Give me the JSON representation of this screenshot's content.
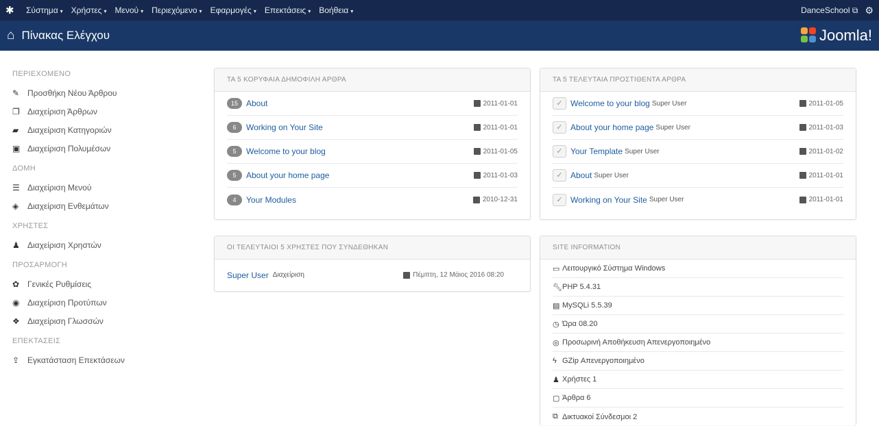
{
  "topbar": {
    "menu": [
      "Σύστημα",
      "Χρήστες",
      "Μενού",
      "Περιεχόμενο",
      "Εφαρμογές",
      "Επεκτάσεις",
      "Βοήθεια"
    ],
    "site_name": "DanceSchool"
  },
  "title": {
    "page_title": "Πίνακας Ελέγχου",
    "brand": "Joomla!"
  },
  "sidebar": {
    "sections": [
      {
        "heading": "ΠΕΡΙΕΧΟΜΕΝΟ",
        "items": [
          {
            "label": "Προσθήκη Νέου Άρθρου",
            "icon": "pencil-icon"
          },
          {
            "label": "Διαχείριση Άρθρων",
            "icon": "stack-icon"
          },
          {
            "label": "Διαχείριση Κατηγοριών",
            "icon": "folder-icon"
          },
          {
            "label": "Διαχείριση Πολυμέσων",
            "icon": "image-icon"
          }
        ]
      },
      {
        "heading": "ΔΟΜΗ",
        "items": [
          {
            "label": "Διαχείριση Μενού",
            "icon": "list-icon"
          },
          {
            "label": "Διαχείριση Ενθεμάτων",
            "icon": "cube-icon"
          }
        ]
      },
      {
        "heading": "ΧΡΗΣΤΕΣ",
        "items": [
          {
            "label": "Διαχείριση Χρηστών",
            "icon": "users-icon"
          }
        ]
      },
      {
        "heading": "ΠΡΟΣΑΡΜΟΓΗ",
        "items": [
          {
            "label": "Γενικές Ρυθμίσεις",
            "icon": "cog-icon"
          },
          {
            "label": "Διαχείριση Προτύπων",
            "icon": "eye-icon"
          },
          {
            "label": "Διαχείριση Γλωσσών",
            "icon": "comments-icon"
          }
        ]
      },
      {
        "heading": "ΕΠΕΚΤΑΣΕΙΣ",
        "items": [
          {
            "label": "Εγκατάσταση Επεκτάσεων",
            "icon": "upload-icon"
          }
        ]
      }
    ]
  },
  "popular": {
    "heading": "ΤΑ 5 ΚΟΡΥΦΑΙΑ ΔΗΜΟΦΙΛΗ ΑΡΘΡΑ",
    "rows": [
      {
        "hits": "15",
        "title": "About",
        "date": "2011-01-01"
      },
      {
        "hits": "6",
        "title": "Working on Your Site",
        "date": "2011-01-01"
      },
      {
        "hits": "5",
        "title": "Welcome to your blog",
        "date": "2011-01-05"
      },
      {
        "hits": "5",
        "title": "About your home page",
        "date": "2011-01-03"
      },
      {
        "hits": "4",
        "title": "Your Modules",
        "date": "2010-12-31"
      }
    ]
  },
  "latest": {
    "heading": "ΤΑ 5 ΤΕΛΕΥΤΑΙΑ ΠΡΟΣΤΙΘΕΝΤΑ ΑΡΘΡΑ",
    "rows": [
      {
        "title": "Welcome to your blog",
        "author": "Super User",
        "date": "2011-01-05"
      },
      {
        "title": "About your home page",
        "author": "Super User",
        "date": "2011-01-03"
      },
      {
        "title": "Your Template",
        "author": "Super User",
        "date": "2011-01-02"
      },
      {
        "title": "About",
        "author": "Super User",
        "date": "2011-01-01"
      },
      {
        "title": "Working on Your Site",
        "author": "Super User",
        "date": "2011-01-01"
      }
    ]
  },
  "logged": {
    "heading": "ΟΙ ΤΕΛΕΥΤΑΙΟΙ 5 ΧΡΗΣΤΕΣ ΠΟΥ ΣΥΝΔΕΘΗΚΑΝ",
    "rows": [
      {
        "name": "Super User",
        "client": "Διαχείριση",
        "date": "Πέμπτη, 12 Μάιος 2016 08:20"
      }
    ]
  },
  "siteinfo": {
    "heading": "SITE INFORMATION",
    "rows": [
      {
        "icon": "monitor-icon",
        "text": "Λειτουργικό Σύστημα Windows"
      },
      {
        "icon": "wrench-icon",
        "text": "PHP 5.4.31"
      },
      {
        "icon": "database-icon",
        "text": "MySQLi 5.5.39"
      },
      {
        "icon": "clock-icon",
        "text": "Ώρα 08.20"
      },
      {
        "icon": "cache-icon",
        "text": "Προσωρινή Αποθήκευση Απενεργοποιημένο"
      },
      {
        "icon": "flash-icon",
        "text": "GZip Απενεργοποιημένο"
      },
      {
        "icon": "users-icon",
        "text": "Χρήστες 1"
      },
      {
        "icon": "file-icon",
        "text": "Άρθρα 6"
      },
      {
        "icon": "link-icon",
        "text": "Δικτυακοί Σύνδεσμοι 2"
      }
    ]
  },
  "colors": {
    "topbar": "#16284d",
    "titlebar": "#1a3867",
    "link": "#1f5c9e"
  }
}
